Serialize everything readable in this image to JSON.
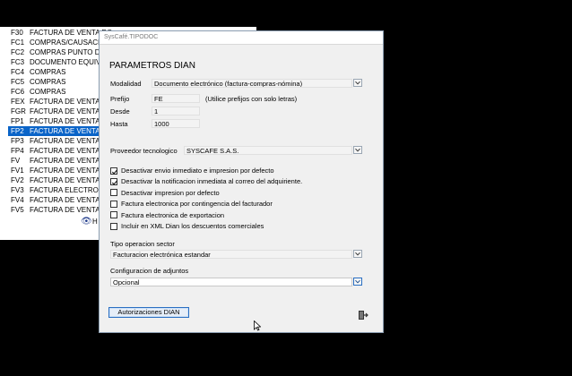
{
  "background_list": {
    "rows": [
      {
        "code": "F30",
        "desc": "FACTURA DE VENTA RO",
        "selected": false
      },
      {
        "code": "FC1",
        "desc": "COMPRAS/CAUSACIO",
        "selected": false
      },
      {
        "code": "FC2",
        "desc": "COMPRAS PUNTO DE V",
        "selected": false
      },
      {
        "code": "FC3",
        "desc": "DOCUMENTO EQUIVAL",
        "selected": false
      },
      {
        "code": "FC4",
        "desc": "COMPRAS",
        "selected": false
      },
      {
        "code": "FC5",
        "desc": "COMPRAS",
        "selected": false
      },
      {
        "code": "FC6",
        "desc": "COMPRAS",
        "selected": false
      },
      {
        "code": "FEX",
        "desc": "FACTURA DE VENTA EX",
        "selected": false
      },
      {
        "code": "FGR",
        "desc": "FACTURA DE VENTA",
        "selected": false
      },
      {
        "code": "FP1",
        "desc": "FACTURA DE VENTA PO",
        "selected": false
      },
      {
        "code": "FP2",
        "desc": "FACTURA DE VENTA EL",
        "selected": true
      },
      {
        "code": "FP3",
        "desc": "FACTURA DE VENTA PO",
        "selected": false
      },
      {
        "code": "FP4",
        "desc": "FACTURA DE VENTA PO",
        "selected": false
      },
      {
        "code": "FV",
        "desc": "FACTURA DE VENTA SE",
        "selected": false
      },
      {
        "code": "FV1",
        "desc": "FACTURA DE VENTA PO",
        "selected": false
      },
      {
        "code": "FV2",
        "desc": "FACTURA DE VENTA",
        "selected": false
      },
      {
        "code": "FV3",
        "desc": "FACTURA ELECTRONIC",
        "selected": false
      },
      {
        "code": "FV4",
        "desc": "FACTURA DE VENTA LO",
        "selected": false
      },
      {
        "code": "FV5",
        "desc": "FACTURA DE VENTA",
        "selected": false
      }
    ],
    "bottom_label": "H"
  },
  "dialog": {
    "title": "SysCafé.TIPODOC",
    "heading": "PARAMETROS DIAN",
    "modalidad_label": "Modalidad",
    "modalidad_value": "Documento electrónico (factura-compras-nómina)",
    "prefijo_label": "Prefijo",
    "prefijo_value": "FE",
    "prefijo_hint": "(Utilice prefijos con solo letras)",
    "desde_label": "Desde",
    "desde_value": "1",
    "hasta_label": "Hasta",
    "hasta_value": "1000",
    "proveedor_label": "Proveedor tecnologico",
    "proveedor_value": "SYSCAFE S.A.S.",
    "checkboxes": [
      {
        "label": "Desactivar envio inmediato e impresion por defecto",
        "checked": true
      },
      {
        "label": "Desactivar la notificacion inmediata al correo del adquiriente.",
        "checked": true
      },
      {
        "label": "Desactivar impresion por defecto",
        "checked": false
      },
      {
        "label": "Factura electronica por contingencia del facturador",
        "checked": false
      },
      {
        "label": "Factura electronica de exportacion",
        "checked": false
      },
      {
        "label": "Incluir en XML Dian los descuentos comerciales",
        "checked": false
      }
    ],
    "tipo_operacion_label": "Tipo operacion sector",
    "tipo_operacion_value": "Facturacion electrónica estandar",
    "config_adjuntos_label": "Configuracion de adjuntos",
    "config_adjuntos_value": "Opcional",
    "auth_button": "Autorizaciones DIAN"
  }
}
